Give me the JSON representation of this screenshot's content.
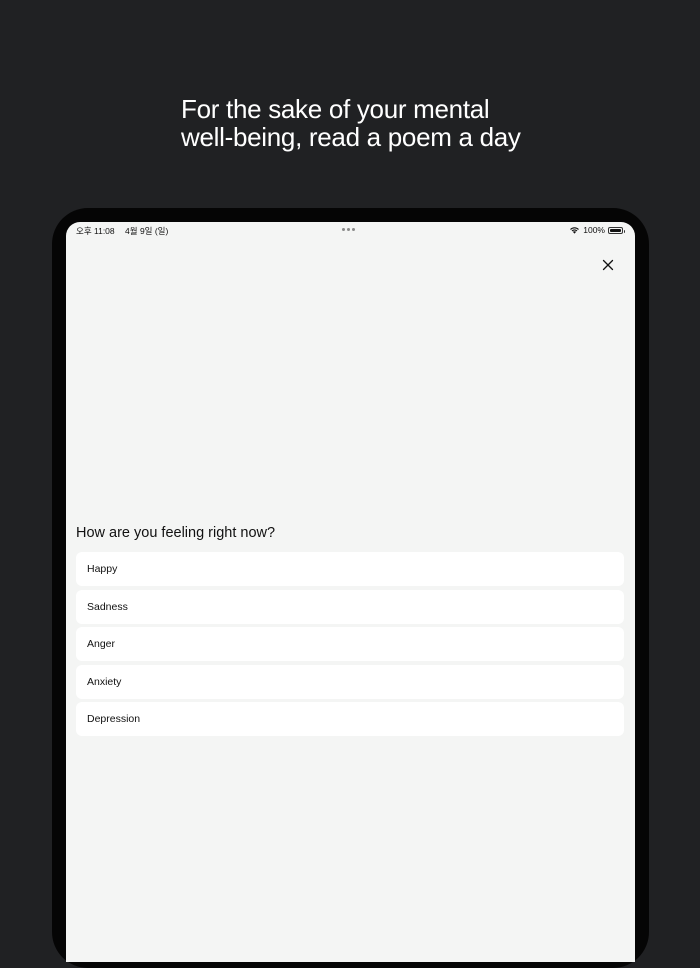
{
  "headline": {
    "line1": "For the sake of your mental",
    "line2": "well-being, read a poem a day"
  },
  "status_bar": {
    "time": "오후 11:08",
    "date": "4월 9일 (일)",
    "battery": "100%"
  },
  "modal": {
    "question": "How are you feeling right now?",
    "options": [
      {
        "label": "Happy"
      },
      {
        "label": "Sadness"
      },
      {
        "label": "Anger"
      },
      {
        "label": "Anxiety"
      },
      {
        "label": "Depression"
      }
    ]
  },
  "icons": {
    "close": "close-icon",
    "wifi": "wifi-icon",
    "battery": "battery-icon",
    "multitask": "more-dots-icon"
  },
  "colors": {
    "background": "#202123",
    "device_frame": "#050505",
    "screen": "#f4f5f4",
    "card": "#ffffff",
    "text": "#111111",
    "headline_text": "#ffffff"
  }
}
